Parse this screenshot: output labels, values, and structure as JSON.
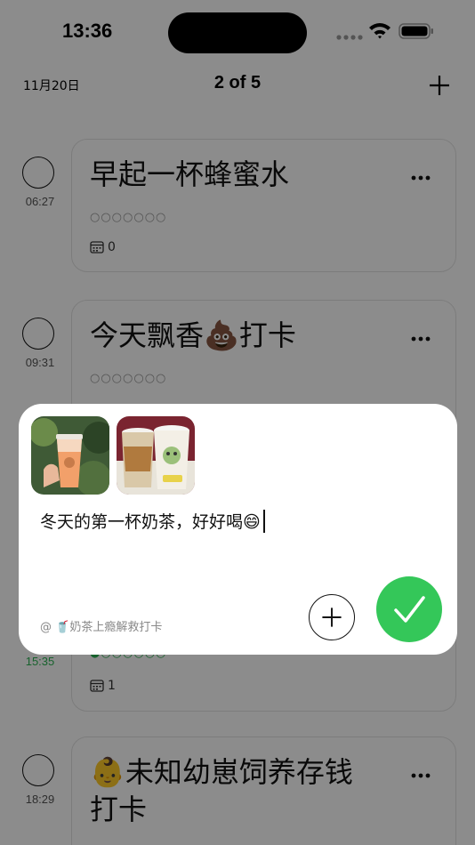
{
  "status_bar": {
    "time": "13:36",
    "icons": [
      "cellular-signal-icon",
      "wifi-icon",
      "battery-icon"
    ]
  },
  "header": {
    "date": "11月20日",
    "page_indicator": "2 of 5",
    "add_icon": "plus-icon"
  },
  "habits": [
    {
      "title": "早起一杯蜂蜜水",
      "time": "06:27",
      "progress_dots": "○○○○○○○",
      "count": "0",
      "checked": false
    },
    {
      "title": "今天飘香💩打卡",
      "time": "09:31",
      "progress_dots": "○○○○○○○",
      "count": "",
      "checked": false
    },
    {
      "title": "",
      "time": "15:35",
      "progress_dots": "●○○○○○○",
      "count": "1",
      "checked": true
    },
    {
      "title": "👶未知幼崽饲养存钱打卡",
      "time": "18:29",
      "progress_dots": "",
      "count": "",
      "checked": false
    }
  ],
  "compose": {
    "text": "冬天的第一杯奶茶，好好喝😄",
    "mention": "@ 🥤奶茶上瘾解救打卡",
    "photos": [
      "milk-tea-photo",
      "two-cups-photo"
    ],
    "add_icon": "plus-icon",
    "confirm_icon": "checkmark-icon"
  },
  "colors": {
    "accent_green": "#34c759",
    "time_green": "#2bb352",
    "dim_overlay": "rgba(0,0,0,0.45)"
  }
}
